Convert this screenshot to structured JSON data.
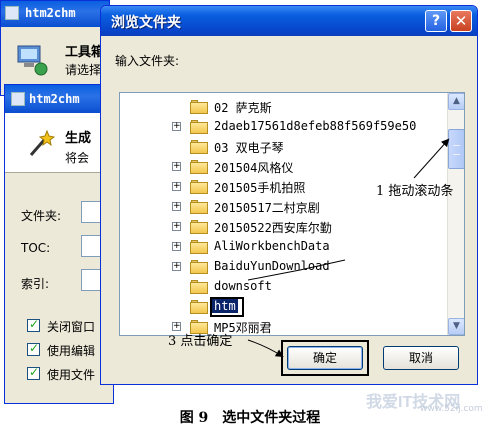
{
  "background_window_1": {
    "title": "htm2chm",
    "heading": "工具箱",
    "subtitle": "请选择"
  },
  "background_window_2": {
    "title": "htm2chm",
    "heading": "生成",
    "subtitle": "将会",
    "fields": [
      {
        "label": "文件夹:"
      },
      {
        "label": "TOC:"
      },
      {
        "label": "索引:"
      }
    ],
    "checkboxes": [
      {
        "label": "关闭窗口",
        "checked": true
      },
      {
        "label": "使用编辑",
        "checked": true
      },
      {
        "label": "使用文件",
        "checked": true
      }
    ]
  },
  "dialog": {
    "title": "浏览文件夹",
    "help_label": "?",
    "close_label": "✕",
    "prompt": "输入文件夹:",
    "folders": [
      {
        "label": "02 萨克斯",
        "expander": false
      },
      {
        "label": "2daeb17561d8efeb88f569f59e50",
        "expander": true
      },
      {
        "label": "03 双电子琴",
        "expander": false
      },
      {
        "label": "201504风格仪",
        "expander": true
      },
      {
        "label": "201505手机拍照",
        "expander": true
      },
      {
        "label": "20150517二村京剧",
        "expander": true
      },
      {
        "label": "20150522西安库尔勤",
        "expander": true
      },
      {
        "label": "AliWorkbenchData",
        "expander": true
      },
      {
        "label": "BaiduYunDownload",
        "expander": true
      },
      {
        "label": "downsoft",
        "expander": false
      },
      {
        "label": "htm",
        "expander": false,
        "selected": true
      },
      {
        "label": "MP5邓丽君",
        "expander": true
      }
    ],
    "ok_label": "确定",
    "cancel_label": "取消"
  },
  "annotations": {
    "scroll_note": "1 拖动滚动条",
    "ok_note": "3 点击确定",
    "caption": "图 9　选中文件夹过程"
  },
  "watermark": {
    "text": "我爱IT技术网",
    "url": "www.52ij.com"
  },
  "colors": {
    "titlebar": "#0a5fe0",
    "selection": "#0a246a",
    "dialog_bg": "#ece9d8"
  }
}
